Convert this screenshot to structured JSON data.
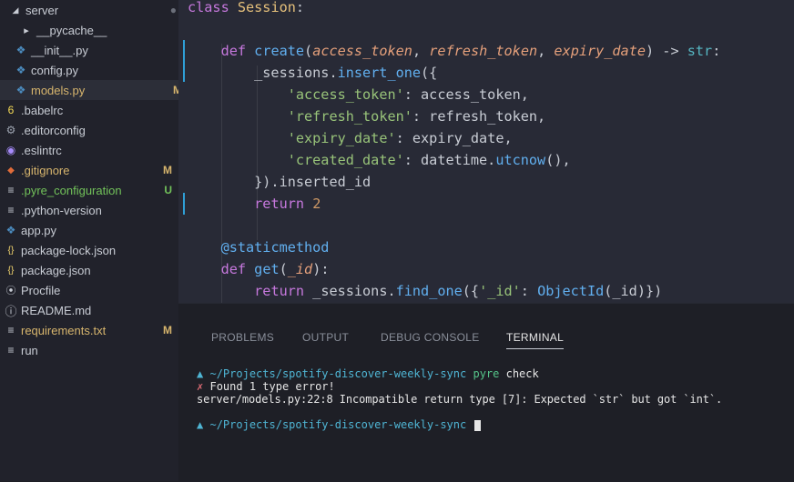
{
  "explorer": {
    "items": [
      {
        "label": "server",
        "icon": "chevron-down-icon",
        "badge": "●",
        "name": "folder-server"
      },
      {
        "label": "__pycache__",
        "icon": "chevron-right-icon",
        "badge": "",
        "name": "folder-pycache"
      },
      {
        "label": "__init__.py",
        "icon": "python-file-icon",
        "badge": "",
        "name": "file-init-py"
      },
      {
        "label": "config.py",
        "icon": "python-file-icon",
        "badge": "",
        "name": "file-config-py"
      },
      {
        "label": "models.py",
        "icon": "python-file-icon",
        "badge": "M",
        "name": "file-models-py"
      },
      {
        "label": ".babelrc",
        "icon": "babel-icon",
        "badge": "",
        "name": "file-babelrc"
      },
      {
        "label": ".editorconfig",
        "icon": "gear-icon",
        "badge": "",
        "name": "file-editorconfig"
      },
      {
        "label": ".eslintrc",
        "icon": "eslint-icon",
        "badge": "",
        "name": "file-eslintrc"
      },
      {
        "label": ".gitignore",
        "icon": "git-icon",
        "badge": "M",
        "name": "file-gitignore"
      },
      {
        "label": ".pyre_configuration",
        "icon": "text-file-icon",
        "badge": "U",
        "name": "file-pyre-configuration"
      },
      {
        "label": ".python-version",
        "icon": "text-file-icon",
        "badge": "",
        "name": "file-python-version"
      },
      {
        "label": "app.py",
        "icon": "python-file-icon",
        "badge": "",
        "name": "file-app-py"
      },
      {
        "label": "package-lock.json",
        "icon": "json-icon",
        "badge": "",
        "name": "file-package-lock-json"
      },
      {
        "label": "package.json",
        "icon": "json-icon",
        "badge": "",
        "name": "file-package-json"
      },
      {
        "label": "Procfile",
        "icon": "procfile-icon",
        "badge": "",
        "name": "file-procfile"
      },
      {
        "label": "README.md",
        "icon": "info-icon",
        "badge": "",
        "name": "file-readme-md"
      },
      {
        "label": "requirements.txt",
        "icon": "text-file-icon",
        "badge": "M",
        "name": "file-requirements-txt"
      },
      {
        "label": "run",
        "icon": "text-file-icon",
        "badge": "",
        "name": "file-run"
      }
    ]
  },
  "editor": {
    "lines": [
      "class Session:",
      "",
      "    def create(access_token, refresh_token, expiry_date) -> str:",
      "        _sessions.insert_one({",
      "            'access_token': access_token,",
      "            'refresh_token': refresh_token,",
      "            'expiry_date': expiry_date,",
      "            'created_date': datetime.utcnow(),",
      "        }).inserted_id",
      "        return 2",
      "",
      "    @staticmethod",
      "    def get(_id):",
      "        return _sessions.find_one({'_id': ObjectId(_id)})"
    ]
  },
  "panel": {
    "tabs": [
      "PROBLEMS",
      "OUTPUT",
      "DEBUG CONSOLE",
      "TERMINAL"
    ],
    "active_tab": "TERMINAL",
    "terminal": {
      "prompt_symbol": "▲",
      "path": "~/Projects/spotify-discover-weekly-sync",
      "command": "pyre",
      "command_arg": "check",
      "error_mark": "✗",
      "error_summary": "Found 1 type error!",
      "error_detail": "server/models.py:22:8 Incompatible return type [7]: Expected `str` but got `int`."
    }
  },
  "colors": {
    "modified": "#d7b56d",
    "untracked": "#72c25a",
    "sidebar_text": "#c8ccd4",
    "folder_badge": "#6b6f7a"
  }
}
